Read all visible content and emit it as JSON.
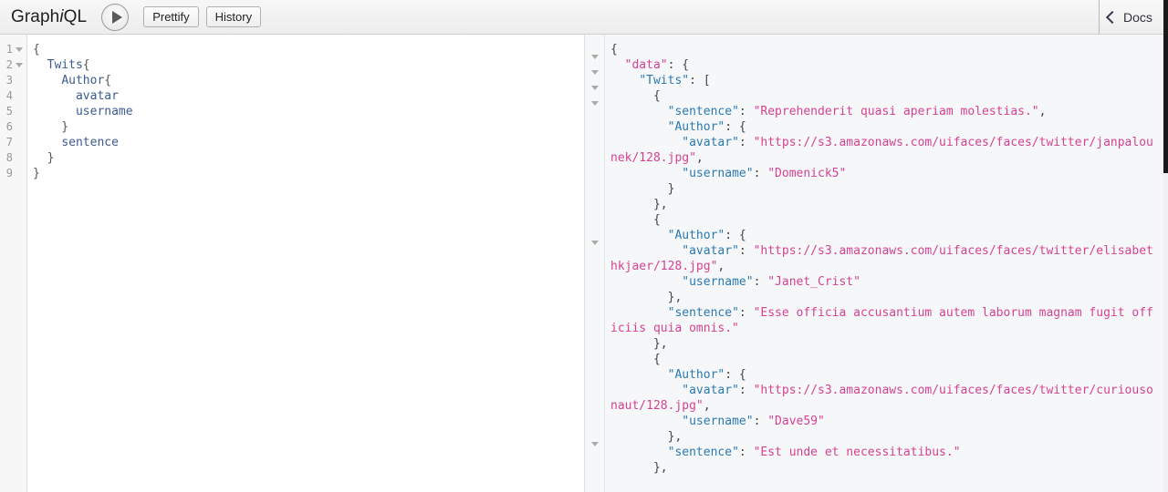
{
  "toolbar": {
    "logo_prefix": "Graph",
    "logo_italic": "i",
    "logo_suffix": "QL",
    "execute_icon": "play-icon",
    "prettify_label": "Prettify",
    "history_label": "History",
    "docs_label": "Docs",
    "docs_icon": "chevron-left-icon"
  },
  "query_editor": {
    "line_numbers": [
      "1",
      "2",
      "3",
      "4",
      "5",
      "6",
      "7",
      "8",
      "9"
    ],
    "foldable_lines": [
      1,
      2
    ],
    "lines": [
      "{",
      "  Twits{",
      "    Author{",
      "      avatar",
      "      username",
      "    }",
      "    sentence",
      "  }",
      "}"
    ]
  },
  "result_viewer": {
    "fold_rows": [
      1,
      2,
      3,
      4,
      12,
      22
    ],
    "lines": [
      [
        {
          "t": "{",
          "c": "jpunct"
        }
      ],
      [
        {
          "t": "  ",
          "c": "jpunct"
        },
        {
          "t": "\"data\"",
          "c": "jkeytop"
        },
        {
          "t": ": {",
          "c": "jpunct"
        }
      ],
      [
        {
          "t": "    ",
          "c": "jpunct"
        },
        {
          "t": "\"Twits\"",
          "c": "jkey"
        },
        {
          "t": ": [",
          "c": "jpunct"
        }
      ],
      [
        {
          "t": "      {",
          "c": "jpunct"
        }
      ],
      [
        {
          "t": "        ",
          "c": "jpunct"
        },
        {
          "t": "\"sentence\"",
          "c": "jkey"
        },
        {
          "t": ": ",
          "c": "jpunct"
        },
        {
          "t": "\"Reprehenderit quasi aperiam molestias.\"",
          "c": "jstr"
        },
        {
          "t": ",",
          "c": "jpunct"
        }
      ],
      [
        {
          "t": "        ",
          "c": "jpunct"
        },
        {
          "t": "\"Author\"",
          "c": "jkey"
        },
        {
          "t": ": {",
          "c": "jpunct"
        }
      ],
      [
        {
          "t": "          ",
          "c": "jpunct"
        },
        {
          "t": "\"avatar\"",
          "c": "jkey"
        },
        {
          "t": ": ",
          "c": "jpunct"
        },
        {
          "t": "\"https://s3.amazonaws.com/uifaces/faces/twitter/janpalounek/128.jpg\"",
          "c": "jstr"
        },
        {
          "t": ",",
          "c": "jpunct"
        }
      ],
      [
        {
          "t": "          ",
          "c": "jpunct"
        },
        {
          "t": "\"username\"",
          "c": "jkey"
        },
        {
          "t": ": ",
          "c": "jpunct"
        },
        {
          "t": "\"Domenick5\"",
          "c": "jstr"
        }
      ],
      [
        {
          "t": "        }",
          "c": "jpunct"
        }
      ],
      [
        {
          "t": "      },",
          "c": "jpunct"
        }
      ],
      [
        {
          "t": "      {",
          "c": "jpunct"
        }
      ],
      [
        {
          "t": "        ",
          "c": "jpunct"
        },
        {
          "t": "\"Author\"",
          "c": "jkey"
        },
        {
          "t": ": {",
          "c": "jpunct"
        }
      ],
      [
        {
          "t": "          ",
          "c": "jpunct"
        },
        {
          "t": "\"avatar\"",
          "c": "jkey"
        },
        {
          "t": ": ",
          "c": "jpunct"
        },
        {
          "t": "\"https://s3.amazonaws.com/uifaces/faces/twitter/elisabethkjaer/128.jpg\"",
          "c": "jstr"
        },
        {
          "t": ",",
          "c": "jpunct"
        }
      ],
      [
        {
          "t": "          ",
          "c": "jpunct"
        },
        {
          "t": "\"username\"",
          "c": "jkey"
        },
        {
          "t": ": ",
          "c": "jpunct"
        },
        {
          "t": "\"Janet_Crist\"",
          "c": "jstr"
        }
      ],
      [
        {
          "t": "        },",
          "c": "jpunct"
        }
      ],
      [
        {
          "t": "        ",
          "c": "jpunct"
        },
        {
          "t": "\"sentence\"",
          "c": "jkey"
        },
        {
          "t": ": ",
          "c": "jpunct"
        },
        {
          "t": "\"Esse officia accusantium autem laborum magnam fugit officiis quia omnis.\"",
          "c": "jstr"
        }
      ],
      [
        {
          "t": "      },",
          "c": "jpunct"
        }
      ],
      [
        {
          "t": "      {",
          "c": "jpunct"
        }
      ],
      [
        {
          "t": "        ",
          "c": "jpunct"
        },
        {
          "t": "\"Author\"",
          "c": "jkey"
        },
        {
          "t": ": {",
          "c": "jpunct"
        }
      ],
      [
        {
          "t": "          ",
          "c": "jpunct"
        },
        {
          "t": "\"avatar\"",
          "c": "jkey"
        },
        {
          "t": ": ",
          "c": "jpunct"
        },
        {
          "t": "\"https://s3.amazonaws.com/uifaces/faces/twitter/curiousonaut/128.jpg\"",
          "c": "jstr"
        },
        {
          "t": ",",
          "c": "jpunct"
        }
      ],
      [
        {
          "t": "          ",
          "c": "jpunct"
        },
        {
          "t": "\"username\"",
          "c": "jkey"
        },
        {
          "t": ": ",
          "c": "jpunct"
        },
        {
          "t": "\"Dave59\"",
          "c": "jstr"
        }
      ],
      [
        {
          "t": "        },",
          "c": "jpunct"
        }
      ],
      [
        {
          "t": "        ",
          "c": "jpunct"
        },
        {
          "t": "\"sentence\"",
          "c": "jkey"
        },
        {
          "t": ": ",
          "c": "jpunct"
        },
        {
          "t": "\"Est unde et necessitatibus.\"",
          "c": "jstr"
        }
      ],
      [
        {
          "t": "      },",
          "c": "jpunct"
        }
      ]
    ]
  },
  "colors": {
    "key_blue": "#2a7ab0",
    "key_pink": "#d64292",
    "string_pink": "#d64292",
    "query_field": "#3b5b92",
    "result_bg": "#f6f7f9"
  }
}
